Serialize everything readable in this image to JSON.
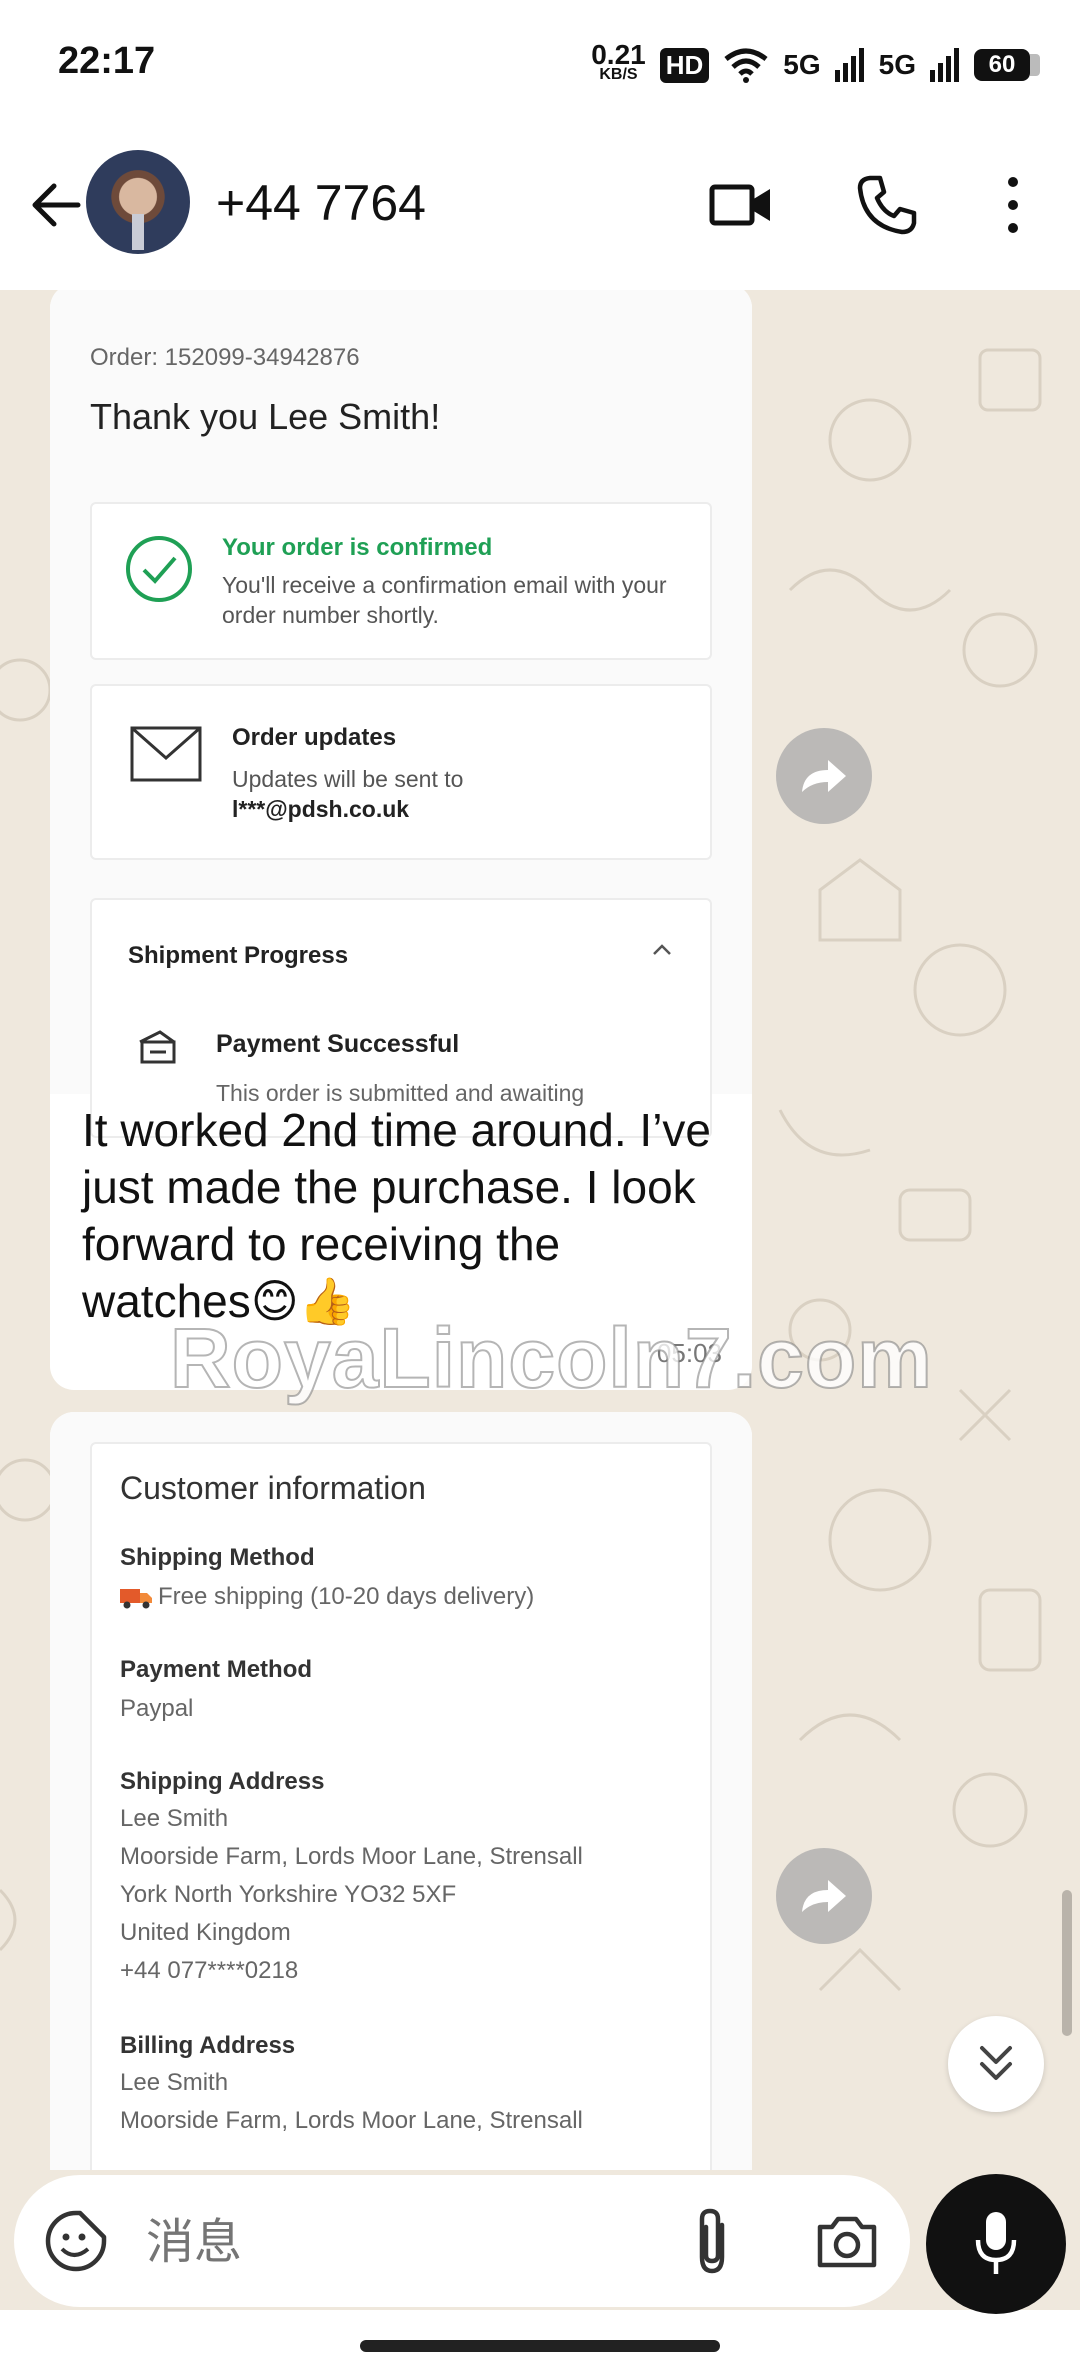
{
  "status_bar": {
    "time": "22:17",
    "net_speed_value": "0.21",
    "net_speed_unit": "KB/S",
    "hd_label": "HD",
    "signal1_label": "5G",
    "signal2_label": "5G",
    "battery_level": "60"
  },
  "header": {
    "contact_name": "+44 7764"
  },
  "message1": {
    "screenshot": {
      "order_number": "Order: 152099-34942876",
      "thank_you": "Thank you Lee Smith!",
      "confirmed_title": "Your order is confirmed",
      "confirmed_text": "You'll receive a confirmation email with your order number shortly.",
      "updates_title": "Order updates",
      "updates_text": "Updates will be sent to",
      "updates_email": "l***@pdsh.co.uk",
      "shipment_title": "Shipment Progress",
      "payment_title": "Payment Successful",
      "payment_text": "This order is submitted and awaiting"
    },
    "text": "It worked 2nd time around. I’ve just made the purchase. I look forward to receiving the watches😊👍",
    "time": "05:03"
  },
  "message2": {
    "screenshot": {
      "heading": "Customer information",
      "shipping_method_label": "Shipping Method",
      "shipping_method_value": "Free shipping  (10-20 days delivery)",
      "payment_method_label": "Payment Method",
      "payment_method_value": "Paypal",
      "shipping_address_label": "Shipping Address",
      "shipping_address_lines": [
        "Lee Smith",
        "Moorside Farm, Lords Moor Lane, Strensall",
        "York North Yorkshire YO32 5XF",
        "United Kingdom",
        "+44 077****0218"
      ],
      "billing_address_label": "Billing Address",
      "billing_address_lines": [
        "Lee Smith",
        "Moorside Farm, Lords Moor Lane, Strensall"
      ]
    }
  },
  "watermark": "RoyaLincoln7.com",
  "input": {
    "placeholder": "消息"
  },
  "colors": {
    "chat_background": "#efe8dd",
    "confirm_green": "#1fa055",
    "mic_button": "#111111"
  },
  "icons": {
    "back": "back-arrow-icon",
    "video": "video-call-icon",
    "phone": "phone-icon",
    "menu": "more-vert-icon",
    "forward": "forward-icon",
    "scroll": "double-chevron-down-icon",
    "emoji": "sticker-icon",
    "attach": "paperclip-icon",
    "camera": "camera-icon",
    "mic": "microphone-icon"
  }
}
